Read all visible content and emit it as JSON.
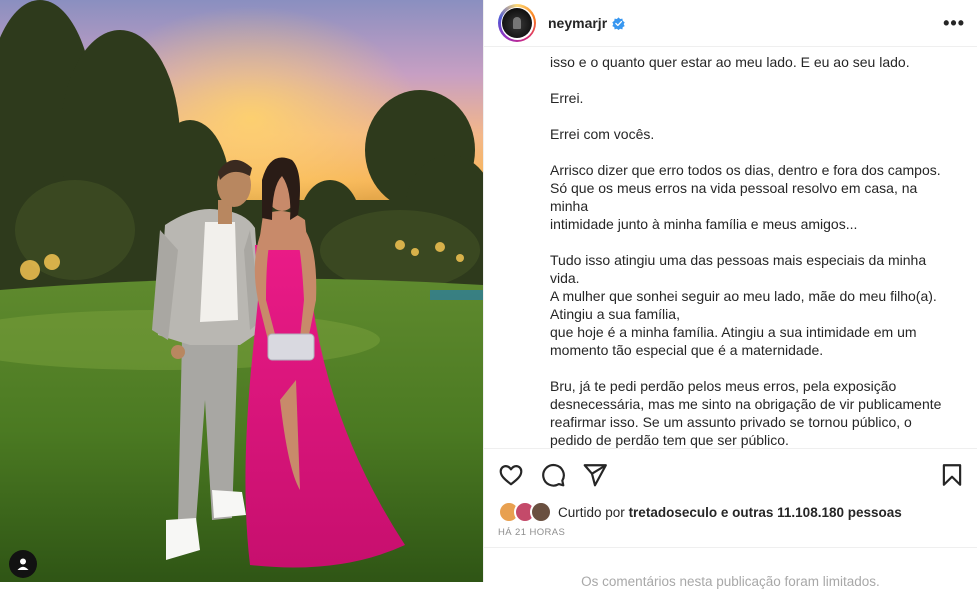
{
  "post": {
    "username": "neymarjr",
    "verified": true,
    "more_label": "•••"
  },
  "caption": {
    "paragraphs": [
      [
        "isso e o quanto quer estar ao meu lado. E eu ao seu lado."
      ],
      [
        "Errei."
      ],
      [
        "Errei com vocês."
      ],
      [
        "Arrisco dizer que erro todos os dias, dentro e fora dos campos.",
        "Só que os meus erros na vida pessoal resolvo em casa, na minha",
        "intimidade junto à minha família e meus amigos..."
      ],
      [
        "Tudo isso atingiu uma das pessoas mais especiais da minha vida.",
        "A mulher que sonhei seguir ao meu lado, mãe do meu filho(a).",
        "Atingiu a sua família,",
        "que hoje é a minha família. Atingiu a sua intimidade em um",
        "momento tão especial que é a maternidade."
      ],
      [
        "Bru, já te pedi perdão pelos meus erros, pela exposição",
        "desnecessária, mas me sinto na obrigação de vir publicamente",
        "reafirmar isso. Se um assunto privado se tornou público, o",
        "pedido de perdão tem que ser público."
      ]
    ]
  },
  "likes": {
    "prefix": "Curtido por",
    "user": "tretadoseculo",
    "connector": "e",
    "others": "outras 11.108.180 pessoas"
  },
  "timestamp": "HÁ 21 HORAS",
  "comments_notice": "Os comentários nesta publicação foram limitados.",
  "icons": {
    "like": "heart-icon",
    "comment": "comment-icon",
    "share": "share-icon",
    "save": "bookmark-icon",
    "tag": "user-tag-icon"
  },
  "colors": {
    "verified": "#3897f0",
    "text": "#262626",
    "muted": "#8e8e8e",
    "dress": "#e0147d"
  }
}
